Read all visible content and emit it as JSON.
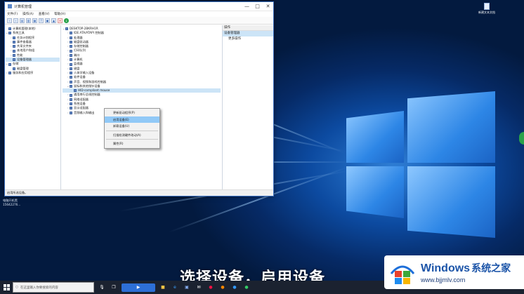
{
  "window": {
    "title": "计算机管理",
    "controls": {
      "minimize": "—",
      "maximize": "□",
      "close": "✕"
    },
    "menu": [
      "文件(F)",
      "操作(A)",
      "查看(V)",
      "帮助(H)"
    ],
    "status": "启用所选设备。"
  },
  "left_tree": [
    {
      "label": "计算机管理(本地)",
      "expander": "",
      "depth": 0,
      "selected": false
    },
    {
      "label": "系统工具",
      "expander": "⌄",
      "depth": 0,
      "selected": false
    },
    {
      "label": "任务计划程序",
      "expander": "›",
      "depth": 1,
      "selected": false
    },
    {
      "label": "事件查看器",
      "expander": "›",
      "depth": 1,
      "selected": false
    },
    {
      "label": "共享文件夹",
      "expander": "›",
      "depth": 1,
      "selected": false
    },
    {
      "label": "本地用户和组",
      "expander": "›",
      "depth": 1,
      "selected": false
    },
    {
      "label": "性能",
      "expander": "›",
      "depth": 1,
      "selected": false
    },
    {
      "label": "设备管理器",
      "expander": "",
      "depth": 1,
      "selected": true
    },
    {
      "label": "存储",
      "expander": "⌄",
      "depth": 0,
      "selected": false
    },
    {
      "label": "磁盘管理",
      "expander": "",
      "depth": 1,
      "selected": false
    },
    {
      "label": "服务和应用程序",
      "expander": "›",
      "depth": 0,
      "selected": false
    }
  ],
  "device_tree": [
    {
      "label": "DESKTOP-2BKRH1R",
      "expander": "⌄",
      "depth": 0
    },
    {
      "label": "IDE ATA/ATAPI 控制器",
      "expander": "›",
      "depth": 1
    },
    {
      "label": "处理器",
      "expander": "›",
      "depth": 1
    },
    {
      "label": "磁盘驱动器",
      "expander": "›",
      "depth": 1
    },
    {
      "label": "存储控制器",
      "expander": "›",
      "depth": 1
    },
    {
      "label": "打印队列",
      "expander": "›",
      "depth": 1
    },
    {
      "label": "端口",
      "expander": "›",
      "depth": 1
    },
    {
      "label": "计算机",
      "expander": "›",
      "depth": 1
    },
    {
      "label": "监视器",
      "expander": "›",
      "depth": 1
    },
    {
      "label": "键盘",
      "expander": "›",
      "depth": 1
    },
    {
      "label": "人体学输入设备",
      "expander": "›",
      "depth": 1
    },
    {
      "label": "软件设备",
      "expander": "›",
      "depth": 1
    },
    {
      "label": "声音、视频和游戏控制器",
      "expander": "›",
      "depth": 1
    },
    {
      "label": "鼠标和其他指针设备",
      "expander": "⌄",
      "depth": 1
    },
    {
      "label": "HID-compliant mouse",
      "expander": "",
      "depth": 2
    },
    {
      "label": "通用串行总线控制器",
      "expander": "›",
      "depth": 1
    },
    {
      "label": "网络适配器",
      "expander": "›",
      "depth": 1
    },
    {
      "label": "系统设备",
      "expander": "›",
      "depth": 1
    },
    {
      "label": "显示适配器",
      "expander": "›",
      "depth": 1
    },
    {
      "label": "音频输入和输出",
      "expander": "›",
      "depth": 1
    }
  ],
  "context_menu": [
    {
      "label": "更新驱动程序(P)",
      "highlighted": false,
      "sep_after": false
    },
    {
      "label": "启用设备(E)",
      "highlighted": true,
      "sep_after": false
    },
    {
      "label": "卸载设备(U)",
      "highlighted": false,
      "sep_after": true
    },
    {
      "label": "扫描检测硬件改动(A)",
      "highlighted": false,
      "sep_after": true
    },
    {
      "label": "属性(R)",
      "highlighted": false,
      "sep_after": false
    }
  ],
  "actions_pane": {
    "header": "操作",
    "selected": "设备管理器",
    "more": "更多操作"
  },
  "desktop": {
    "icon_label": "新建文本文档",
    "below_lines": [
      "电脑开机黑",
      "15642276..."
    ]
  },
  "subtitle": "选择设备，启用设备",
  "taskbar": {
    "search_placeholder": "在这里输入你要搜索的内容",
    "tray": ""
  },
  "watermark": {
    "brand": "Windows",
    "brand_cn": "系统之家",
    "url": "www.bjjmlv.com"
  },
  "colors": {
    "accent": "#1b54a8",
    "selection": "#cce4f7",
    "menu_highlight": "#91c9f7",
    "taskbar": "#1b2230"
  }
}
